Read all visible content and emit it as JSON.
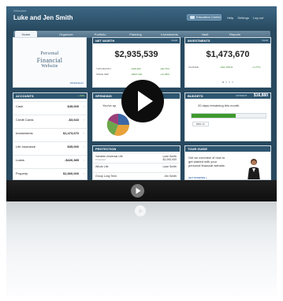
{
  "header": {
    "welcome": "Welcome",
    "user_name": "Luke and Jen Smith",
    "education_center": "Education Center",
    "links": [
      "Help",
      "Settings",
      "Log out"
    ]
  },
  "nav": {
    "tabs": [
      "Home",
      "Organizer",
      "Portfolio",
      "Planning",
      "Investments",
      "Vault",
      "Reports"
    ],
    "active": "Home"
  },
  "logo": {
    "line1": "Personal",
    "line2": "Financial",
    "line3": "Website",
    "admin_link": "All Advisors"
  },
  "net_worth": {
    "title": "NET WORTH",
    "action": "Detail",
    "value": "$2,935,539",
    "rows": [
      {
        "label": "THIS MONTH",
        "change": "+$18,300",
        "pct": "+$4.76%"
      },
      {
        "label": "SINCE SEP",
        "change": "+$297,402",
        "pct": "+14.38%"
      }
    ]
  },
  "investments": {
    "title": "INVESTMENTS",
    "action": "Detail",
    "value": "$1,473,670",
    "row": {
      "label": "CHANGE",
      "change": "+$11,308.01",
      "pct": "+0.77%"
    }
  },
  "accounts": {
    "title": "ACCOUNTS",
    "action": "+ Add",
    "rows": [
      {
        "name": "Cash",
        "value": "$45,000"
      },
      {
        "name": "Credit Cards",
        "value": "-$3,643"
      },
      {
        "name": "Investments",
        "value": "$1,473,670"
      },
      {
        "name": "Life Insurance",
        "value": "$35,000"
      },
      {
        "name": "Loans",
        "value": "-$426,385"
      },
      {
        "name": "Property",
        "value": "$1,800,000"
      }
    ]
  },
  "spending": {
    "title": "SPENDING",
    "text": "You've sp"
  },
  "budgets": {
    "title": "BUDGETS",
    "sub": "UNSPENT",
    "amount": "$16,880",
    "remaining": "20 days remaining this month.",
    "progress": 0.6,
    "label": "$882.16"
  },
  "protection": {
    "title": "PROTECTION",
    "rows": [
      {
        "name": "Variable Universal Life",
        "sub": "Protected",
        "who": "Luke Smith",
        "amt": "$1,000,000"
      },
      {
        "name": "Whole Life",
        "sub": "",
        "who": "Luke Smith",
        "amt": ""
      },
      {
        "name": "Group Long Term",
        "sub": "",
        "who": "Jen Smith",
        "amt": ""
      }
    ]
  },
  "tour": {
    "title": "TOUR GUIDE",
    "lines": [
      "Get an overview of how to",
      "get started with your",
      "personal financial website."
    ],
    "link": "GET STARTED »"
  },
  "colors": {
    "header": "#2f5670",
    "background": "#28495f",
    "accent": "#3a70a8",
    "positive": "#3a8a2e",
    "budget_bar": "#3f9a2e"
  }
}
